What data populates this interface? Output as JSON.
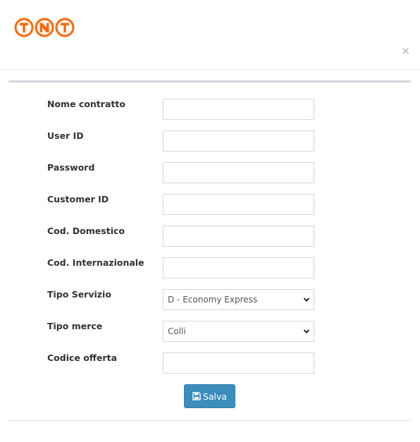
{
  "logo": {
    "text": "TNT",
    "color": "#ff6600"
  },
  "header": {
    "close_label": "×"
  },
  "form": {
    "fields": [
      {
        "label": "Nome contratto",
        "type": "input",
        "value": ""
      },
      {
        "label": "User ID",
        "type": "input",
        "value": ""
      },
      {
        "label": "Password",
        "type": "input",
        "value": ""
      },
      {
        "label": "Customer ID",
        "type": "input",
        "value": ""
      },
      {
        "label": "Cod. Domestico",
        "type": "input",
        "value": ""
      },
      {
        "label": "Cod. Internazionale",
        "type": "input",
        "value": ""
      },
      {
        "label": "Tipo Servizio",
        "type": "select",
        "value": "D - Economy Express"
      },
      {
        "label": "Tipo merce",
        "type": "select",
        "value": "Colli"
      },
      {
        "label": "Codice offerta",
        "type": "input",
        "value": ""
      }
    ],
    "save_label": "Salva",
    "save_icon": "floppy-disk-icon",
    "accent_color": "#3c8dbc"
  }
}
